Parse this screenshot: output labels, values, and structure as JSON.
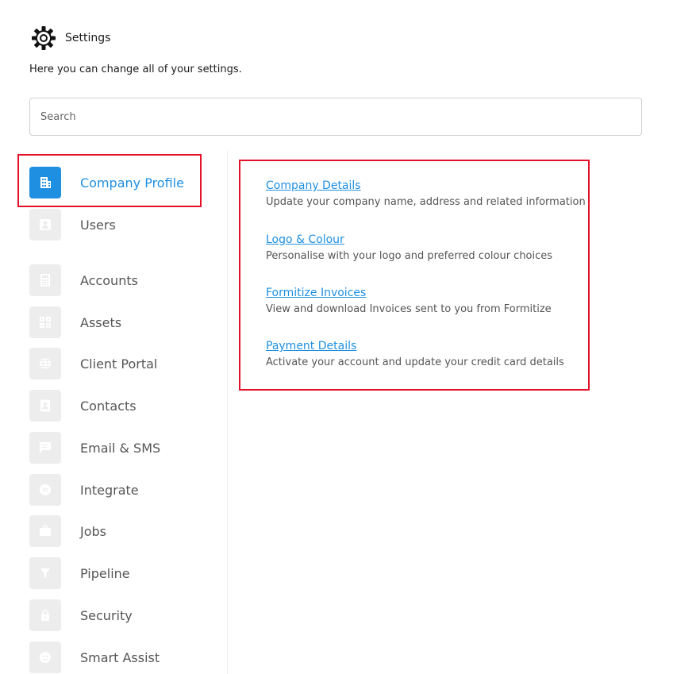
{
  "header": {
    "icon": "gear-icon",
    "title": "Settings",
    "subtitle": "Here you can change all of your settings."
  },
  "search": {
    "placeholder": "Search",
    "value": ""
  },
  "colors": {
    "accent": "#1e8fe1",
    "highlight": "#e3112a",
    "icon_bg": "#ededed"
  },
  "sidebar": {
    "items": [
      {
        "label": "Company Profile",
        "icon": "building-icon",
        "active": true
      },
      {
        "label": "Users",
        "icon": "user-icon",
        "active": false
      },
      {
        "label": "Accounts",
        "icon": "calculator-icon",
        "active": false
      },
      {
        "label": "Assets",
        "icon": "qr-code-icon",
        "active": false
      },
      {
        "label": "Client Portal",
        "icon": "globe-icon",
        "active": false
      },
      {
        "label": "Contacts",
        "icon": "contact-card-icon",
        "active": false
      },
      {
        "label": "Email & SMS",
        "icon": "message-icon",
        "active": false
      },
      {
        "label": "Integrate",
        "icon": "integrate-icon",
        "active": false
      },
      {
        "label": "Jobs",
        "icon": "briefcase-icon",
        "active": false
      },
      {
        "label": "Pipeline",
        "icon": "funnel-icon",
        "active": false
      },
      {
        "label": "Security",
        "icon": "lock-icon",
        "active": false
      },
      {
        "label": "Smart Assist",
        "icon": "smart-assist-icon",
        "active": false
      }
    ]
  },
  "main": {
    "links": [
      {
        "title": "Company Details",
        "description": "Update your company name, address and related information"
      },
      {
        "title": "Logo & Colour",
        "description": "Personalise with your logo and preferred colour choices"
      },
      {
        "title": "Formitize Invoices",
        "description": "View and download Invoices sent to you from Formitize"
      },
      {
        "title": "Payment Details",
        "description": "Activate your account and update your credit card details"
      }
    ]
  }
}
